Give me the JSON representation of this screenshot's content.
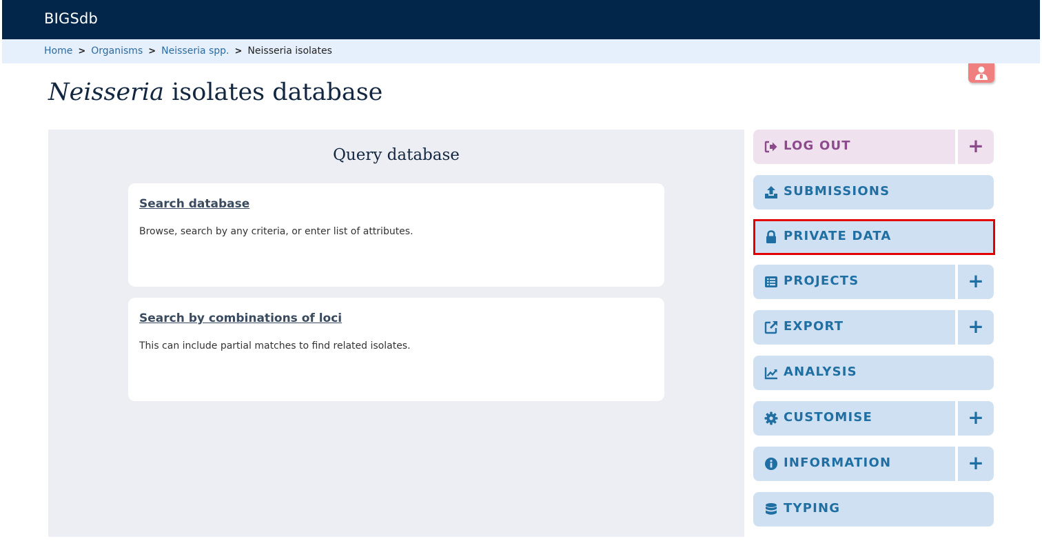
{
  "app": {
    "brand": "BIGSdb"
  },
  "breadcrumb": {
    "items": [
      {
        "label": "Home"
      },
      {
        "label": "Organisms"
      },
      {
        "label": "Neisseria spp."
      },
      {
        "label": "Neisseria isolates"
      }
    ],
    "separator": ">"
  },
  "page": {
    "title_italic": "Neisseria",
    "title_rest": " isolates database"
  },
  "query_panel": {
    "title": "Query database",
    "cards": [
      {
        "link": "Search database",
        "description": "Browse, search by any criteria, or enter list of attributes."
      },
      {
        "link": "Search by combinations of loci",
        "description": "This can include partial matches to find related isolates."
      }
    ]
  },
  "sidebar": {
    "items": [
      {
        "label": "LOG OUT",
        "icon": "logout-icon",
        "expandable": true
      },
      {
        "label": "SUBMISSIONS",
        "icon": "upload-icon",
        "expandable": false
      },
      {
        "label": "PRIVATE DATA",
        "icon": "lock-icon",
        "expandable": false,
        "highlighted": true
      },
      {
        "label": "PROJECTS",
        "icon": "list-icon",
        "expandable": true
      },
      {
        "label": "EXPORT",
        "icon": "external-link-icon",
        "expandable": true
      },
      {
        "label": "ANALYSIS",
        "icon": "chart-line-icon",
        "expandable": false
      },
      {
        "label": "CUSTOMISE",
        "icon": "gear-icon",
        "expandable": true
      },
      {
        "label": "INFORMATION",
        "icon": "info-icon",
        "expandable": true
      },
      {
        "label": "TYPING",
        "icon": "database-icon",
        "expandable": false
      }
    ],
    "expand_symbol": "+"
  },
  "colors": {
    "header_bg": "#02264a",
    "breadcrumb_bg": "#e6f0fc",
    "button_bg": "#cfe0f2",
    "button_text": "#1f6fa3",
    "logout_bg": "#f0e1ee",
    "logout_text": "#8c4a8c",
    "highlight": "#e30000",
    "login_badge": "#f08080"
  }
}
